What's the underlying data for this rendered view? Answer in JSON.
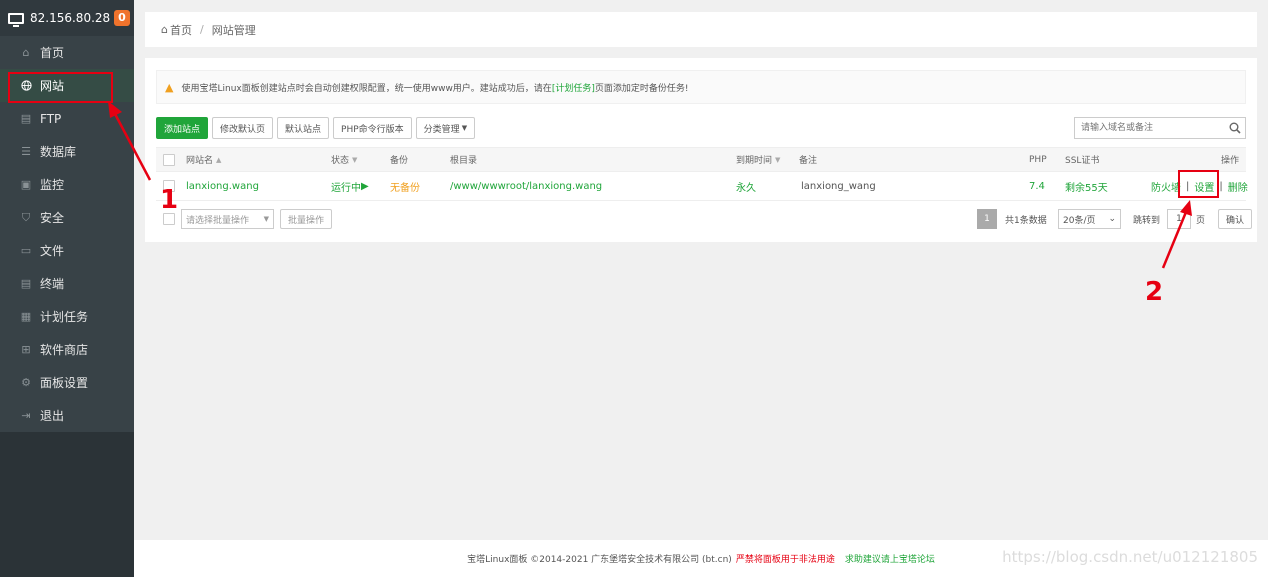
{
  "sidebar": {
    "ip": "82.156.80.28",
    "badge": "0",
    "items": [
      {
        "label": "首页",
        "icon": "home-icon"
      },
      {
        "label": "网站",
        "icon": "globe-icon"
      },
      {
        "label": "FTP",
        "icon": "ftp-icon"
      },
      {
        "label": "数据库",
        "icon": "database-icon"
      },
      {
        "label": "监控",
        "icon": "monitor-icon"
      },
      {
        "label": "安全",
        "icon": "shield-icon"
      },
      {
        "label": "文件",
        "icon": "folder-icon"
      },
      {
        "label": "终端",
        "icon": "terminal-icon"
      },
      {
        "label": "计划任务",
        "icon": "calendar-icon"
      },
      {
        "label": "软件商店",
        "icon": "apps-icon"
      },
      {
        "label": "面板设置",
        "icon": "gear-icon"
      },
      {
        "label": "退出",
        "icon": "logout-icon"
      }
    ]
  },
  "breadcrumb": {
    "home": "首页",
    "sep": "/",
    "current": "网站管理"
  },
  "notice": {
    "before": "使用宝塔Linux面板创建站点时会自动创建权限配置，统一使用www用户。建站成功后，请在",
    "link": "[计划任务]",
    "after": "页面添加定时备份任务!"
  },
  "toolbar": {
    "add": "添加站点",
    "modify_default": "修改默认页",
    "default_site": "默认站点",
    "php_cli": "PHP命令行版本",
    "category": "分类管理"
  },
  "search": {
    "placeholder": "请输入域名或备注"
  },
  "table": {
    "headers": {
      "name": "网站名",
      "status": "状态",
      "backup": "备份",
      "root": "根目录",
      "expire": "到期时间",
      "remark": "备注",
      "php": "PHP",
      "ssl": "SSL证书",
      "action": "操作"
    },
    "rows": [
      {
        "name": "lanxiong.wang",
        "status": "运行中",
        "backup": "无备份",
        "root": "/www/wwwroot/lanxiong.wang",
        "expire": "永久",
        "remark": "lanxiong_wang",
        "php": "7.4",
        "ssl": "剩余55天",
        "firewall": "防火墙",
        "settings": "设置",
        "delete": "删除",
        "pipe": "|"
      }
    ]
  },
  "batch": {
    "placeholder": "请选择批量操作",
    "button": "批量操作"
  },
  "pagination": {
    "page": "1",
    "total": "共1条数据",
    "per_page": "20条/页",
    "jump": "跳转到",
    "jump_value": "1",
    "unit": "页",
    "confirm": "确认"
  },
  "annotations": {
    "one": "1",
    "two": "2"
  },
  "footer": {
    "copyright": "宝塔Linux面板 ©2014-2021 广东堡塔安全技术有限公司 (bt.cn)",
    "warning": "严禁将面板用于非法用途",
    "suggest": "求助建议请上宝塔论坛"
  },
  "watermark": "https://blog.csdn.net/u012121805",
  "colors": {
    "accent": "#20a53a",
    "sidebar": "#2b3337",
    "annotation": "#e60012",
    "warn": "#f0a020"
  }
}
